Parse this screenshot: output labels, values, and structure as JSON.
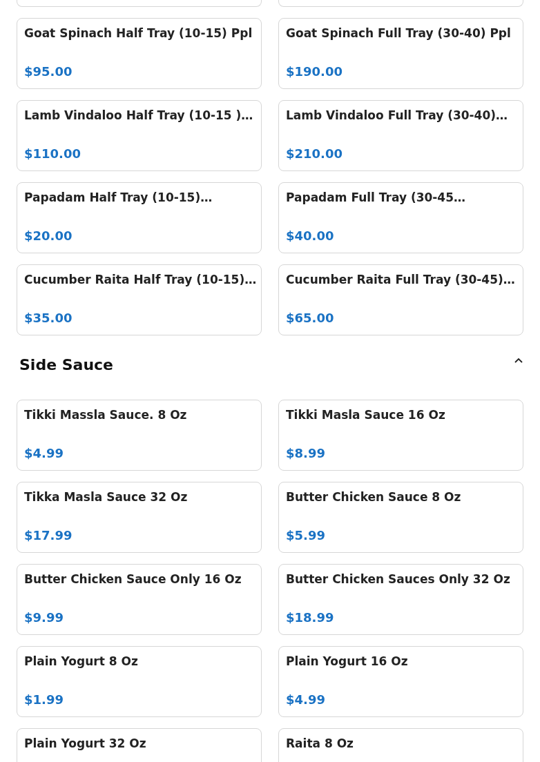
{
  "sections": [
    {
      "items": [
        {
          "name": "Goat Spinach Half Tray (10-15) Ppl",
          "price": "$95.00"
        },
        {
          "name": "Goat Spinach Full Tray (30-40) Ppl",
          "price": "$190.00"
        },
        {
          "name": "Lamb Vindaloo Half Tray (10-15 )…",
          "price": "$110.00"
        },
        {
          "name": "Lamb Vindaloo Full Tray (30-40)…",
          "price": "$210.00"
        },
        {
          "name": "Papadam Half Tray (10-15)…",
          "price": "$20.00"
        },
        {
          "name": "Papadam Full Tray (30-45…",
          "price": "$40.00"
        },
        {
          "name": "Cucumber Raita Half Tray (10-15)…",
          "price": "$35.00"
        },
        {
          "name": "Cucumber Raita Full Tray (30-45)…",
          "price": "$65.00"
        }
      ]
    },
    {
      "title": "Side Sauce",
      "expanded": true,
      "items": [
        {
          "name": "Tikki Massla Sauce. 8 Oz",
          "price": "$4.99"
        },
        {
          "name": "Tikki Masla Sauce 16 Oz",
          "price": "$8.99"
        },
        {
          "name": "Tikka Masla Sauce 32 Oz",
          "price": "$17.99"
        },
        {
          "name": "Butter Chicken Sauce 8 Oz",
          "price": "$5.99"
        },
        {
          "name": "Butter Chicken Sauce Only 16 Oz",
          "price": "$9.99"
        },
        {
          "name": "Butter Chicken Sauces Only 32 Oz",
          "price": "$18.99"
        },
        {
          "name": "Plain Yogurt 8 Oz",
          "price": "$1.99"
        },
        {
          "name": "Plain Yogurt 16 Oz",
          "price": "$4.99"
        },
        {
          "name": "Plain Yogurt 32 Oz"
        },
        {
          "name": "Raita 8 Oz"
        }
      ]
    }
  ]
}
